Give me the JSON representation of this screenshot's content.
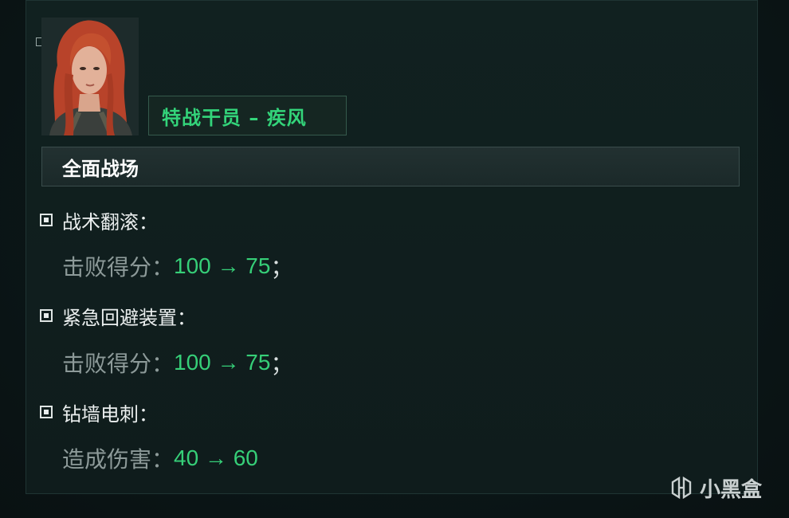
{
  "operator": {
    "name_tag": "特战干员 – 疾风"
  },
  "section": {
    "title": "全面战场"
  },
  "items": [
    {
      "name": "战术翻滚：",
      "label": "击败得分：",
      "value": "100 → 75",
      "suffix": "；"
    },
    {
      "name": "紧急回避装置：",
      "label": "击败得分：",
      "value": "100 → 75",
      "suffix": "；"
    },
    {
      "name": "钻墙电刺：",
      "label": "造成伤害：",
      "value": "40 → 60",
      "suffix": ""
    }
  ],
  "watermark": {
    "text": "小黑盒",
    "icon": "heybox-logo-icon"
  },
  "colors": {
    "accent_green": "#36cf78",
    "panel_bg": "#112120",
    "label_gray": "#8d9a99"
  }
}
